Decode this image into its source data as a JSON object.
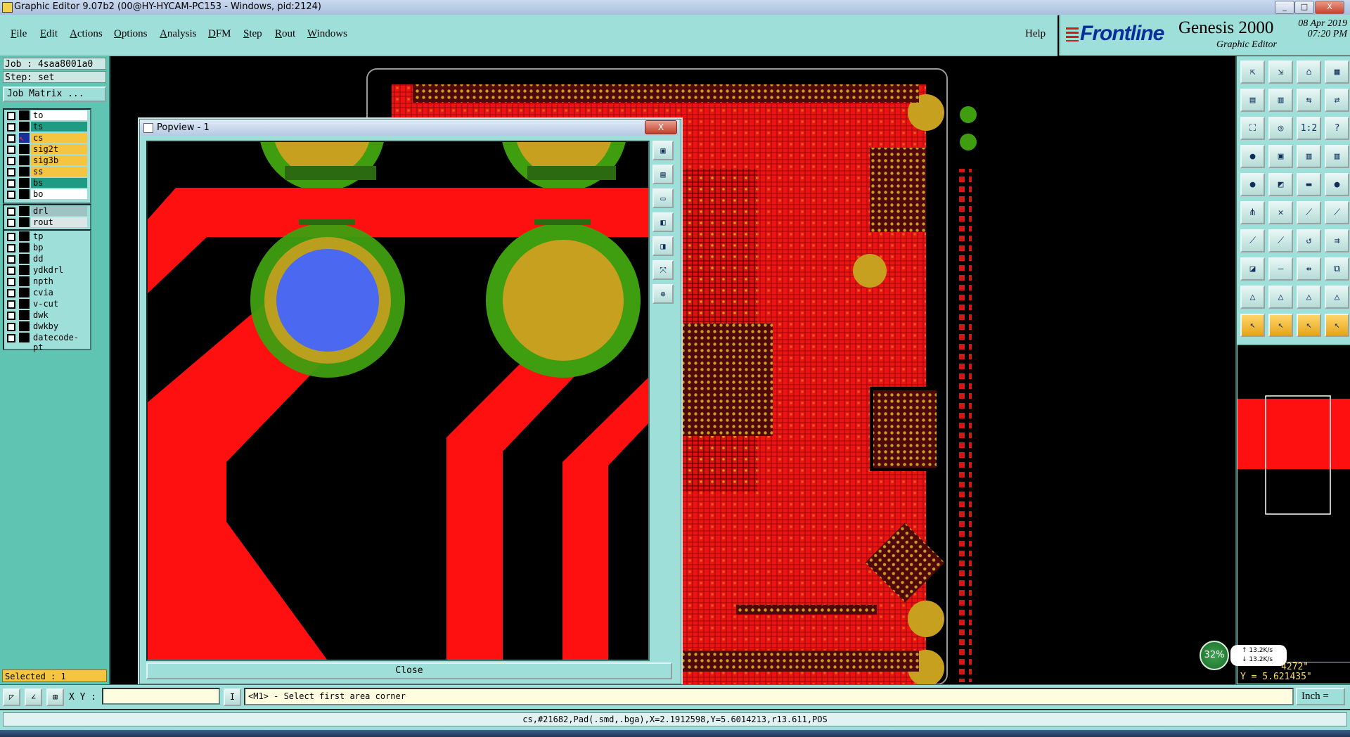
{
  "window": {
    "title": "Graphic Editor 9.07b2 (00@HY-HYCAM-PC153 - Windows, pid:2124)",
    "controls": [
      "_",
      "□",
      "X"
    ]
  },
  "menu": {
    "items": [
      "File",
      "Edit",
      "Actions",
      "Options",
      "Analysis",
      "DFM",
      "Step",
      "Rout",
      "Windows"
    ],
    "help": "Help"
  },
  "brand": {
    "logo": "Frontline",
    "product": "Genesis 2000",
    "subtitle": "Graphic Editor",
    "date": "08 Apr 2019",
    "time": "07:20 PM"
  },
  "job": {
    "job_label": "Job : 4saa8001a0",
    "step_label": "Step: set",
    "matrix_button": "Job Matrix ..."
  },
  "layers_board": [
    {
      "name": "to",
      "color": "#ffffff"
    },
    {
      "name": "ts",
      "color": "#1f9a83"
    },
    {
      "name": "cs",
      "color": "#f5c542",
      "active": true
    },
    {
      "name": "sig2t",
      "color": "#f5c542"
    },
    {
      "name": "sig3b",
      "color": "#f5c542"
    },
    {
      "name": "ss",
      "color": "#f5c542"
    },
    {
      "name": "bs",
      "color": "#1f9a83"
    },
    {
      "name": "bo",
      "color": "#ffffff"
    }
  ],
  "layers_drill": [
    {
      "name": "drl",
      "color": "#9fc2c2"
    },
    {
      "name": "rout",
      "color": "#dde6e6"
    }
  ],
  "layers_misc": [
    {
      "name": "tp",
      "color": "#9fdfd9"
    },
    {
      "name": "bp",
      "color": "#9fdfd9"
    },
    {
      "name": "dd",
      "color": "#9fdfd9"
    },
    {
      "name": "ydkdrl",
      "color": "#9fdfd9"
    },
    {
      "name": "npth",
      "color": "#9fdfd9"
    },
    {
      "name": "cvia",
      "color": "#9fdfd9"
    },
    {
      "name": "v-cut",
      "color": "#9fdfd9"
    },
    {
      "name": "dwk",
      "color": "#9fdfd9"
    },
    {
      "name": "dwkby",
      "color": "#9fdfd9"
    },
    {
      "name": "datecode-pt",
      "color": "#9fdfd9"
    }
  ],
  "selected": "Selected : 1",
  "popview": {
    "title": "Popview - 1",
    "close_x": "X",
    "close_button": "Close"
  },
  "right_tools": [
    "zoom-home-icon",
    "zoom-in-icon",
    "home-icon",
    "grid-icon",
    "snap-icon",
    "undo-icon",
    "pan-icon",
    "step-icon",
    "fit-icon",
    "center-icon",
    "scale-icon",
    "help-icon",
    "measure-icon",
    "mesh-icon",
    "layer-icon",
    "layer-alt-icon",
    "pad-icon",
    "select-icon",
    "ruler-icon",
    "dot-icon",
    "net-icon",
    "cross-icon",
    "connect-icon",
    "connect-alt-icon",
    "line-icon",
    "diag-icon",
    "arc-icon",
    "route-icon",
    "move-icon",
    "shift-icon",
    "mirror-icon",
    "copy-icon",
    "text-icon",
    "text-alt-icon",
    "poly-icon",
    "contour-icon",
    "cursor-icon",
    "cursor-alt-icon",
    "pointer-icon",
    "pointer-alt-icon"
  ],
  "coords": {
    "x": "4272\"",
    "y": "Y = 5.621435\""
  },
  "network": {
    "percent": "32%",
    "up": "13.2K/s",
    "down": "13.2K/s"
  },
  "command": {
    "xy_label": "X Y :",
    "xy_value": "",
    "prompt": "<M1> - Select first area corner",
    "unit": "Inch ="
  },
  "info_line": "cs,#21682,Pad(.smd,.bga),X=2.1912598,Y=5.6014213,r13.611,POS",
  "colors": {
    "panel": "#9fdfd9",
    "trace": "#ff1010",
    "pad": "#c8a020",
    "mask": "#3f9e10",
    "selected_pad": "#4a68f0"
  }
}
